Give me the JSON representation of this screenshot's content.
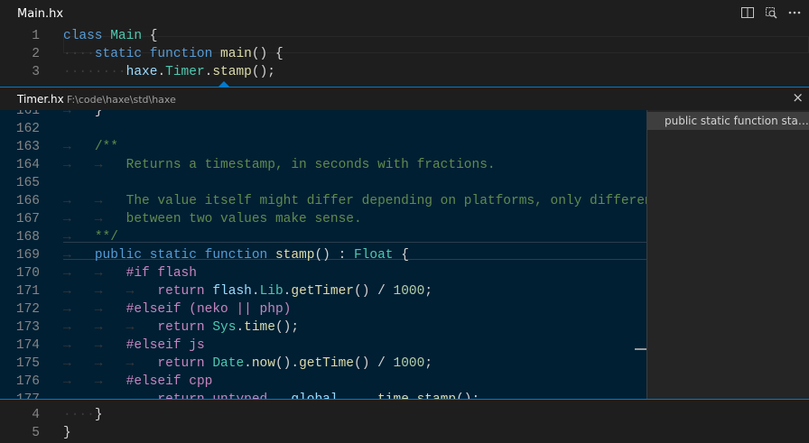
{
  "editor": {
    "tab_title": "Main.hx",
    "actions": [
      "split-editor-icon",
      "open-changes-icon",
      "more-actions-icon"
    ],
    "top_lines": [
      {
        "n": "1",
        "tokens": [
          [
            "kw",
            "class "
          ],
          [
            "ty",
            "Main"
          ],
          [
            "pl",
            " {"
          ]
        ]
      },
      {
        "n": "2",
        "tokens": [
          [
            "ws",
            "····"
          ],
          [
            "kw",
            "static function "
          ],
          [
            "fn",
            "main"
          ],
          [
            "pl",
            "() {"
          ]
        ]
      },
      {
        "n": "3",
        "tokens": [
          [
            "ws",
            "········"
          ],
          [
            "id",
            "haxe"
          ],
          [
            "pl",
            "."
          ],
          [
            "ty",
            "Timer"
          ],
          [
            "pl",
            "."
          ],
          [
            "fn",
            "stamp"
          ],
          [
            "pl",
            "();"
          ]
        ]
      }
    ],
    "bottom_lines": [
      {
        "n": "4",
        "tokens": [
          [
            "ws",
            "····"
          ],
          [
            "pl",
            "}"
          ]
        ]
      },
      {
        "n": "5",
        "tokens": [
          [
            "pl",
            "}"
          ]
        ]
      }
    ]
  },
  "peek": {
    "file": "Timer.hx",
    "path": "F:\\code\\haxe\\std\\haxe",
    "close_label": "×",
    "reference": "public static function stamp() : Float",
    "lines": [
      {
        "n": "161",
        "tokens": [
          [
            "ws",
            "→   "
          ],
          [
            "pl",
            "}"
          ]
        ]
      },
      {
        "n": "162",
        "tokens": []
      },
      {
        "n": "163",
        "tokens": [
          [
            "ws",
            "→   "
          ],
          [
            "cm",
            "/**"
          ]
        ]
      },
      {
        "n": "164",
        "tokens": [
          [
            "ws",
            "→   →   "
          ],
          [
            "cm",
            "Returns a timestamp, in seconds with fractions."
          ]
        ]
      },
      {
        "n": "165",
        "tokens": []
      },
      {
        "n": "166",
        "tokens": [
          [
            "ws",
            "→   →   "
          ],
          [
            "cm",
            "The value itself might differ depending on platforms, only differences"
          ]
        ]
      },
      {
        "n": "167",
        "tokens": [
          [
            "ws",
            "→   →   "
          ],
          [
            "cm",
            "between two values make sense."
          ]
        ]
      },
      {
        "n": "168",
        "tokens": [
          [
            "ws",
            "→   "
          ],
          [
            "cm",
            "**/"
          ]
        ]
      },
      {
        "n": "169",
        "tokens": [
          [
            "ws",
            "→   "
          ],
          [
            "kw",
            "public static function "
          ],
          [
            "fn",
            "stamp"
          ],
          [
            "pl",
            "() : "
          ],
          [
            "ty",
            "Float"
          ],
          [
            "pl",
            " {"
          ]
        ]
      },
      {
        "n": "170",
        "tokens": [
          [
            "ws",
            "→   →   "
          ],
          [
            "pp",
            "#if flash"
          ]
        ]
      },
      {
        "n": "171",
        "tokens": [
          [
            "ws",
            "→   →   →   "
          ],
          [
            "pp",
            "return "
          ],
          [
            "id",
            "flash"
          ],
          [
            "pl",
            "."
          ],
          [
            "ty",
            "Lib"
          ],
          [
            "pl",
            "."
          ],
          [
            "fn",
            "getTimer"
          ],
          [
            "pl",
            "() / "
          ],
          [
            "num",
            "1000"
          ],
          [
            "pl",
            ";"
          ]
        ]
      },
      {
        "n": "172",
        "tokens": [
          [
            "ws",
            "→   →   "
          ],
          [
            "pp",
            "#elseif (neko || php)"
          ]
        ]
      },
      {
        "n": "173",
        "tokens": [
          [
            "ws",
            "→   →   →   "
          ],
          [
            "pp",
            "return "
          ],
          [
            "ty",
            "Sys"
          ],
          [
            "pl",
            "."
          ],
          [
            "fn",
            "time"
          ],
          [
            "pl",
            "();"
          ]
        ]
      },
      {
        "n": "174",
        "tokens": [
          [
            "ws",
            "→   →   "
          ],
          [
            "pp",
            "#elseif js"
          ]
        ]
      },
      {
        "n": "175",
        "tokens": [
          [
            "ws",
            "→   →   →   "
          ],
          [
            "pp",
            "return "
          ],
          [
            "ty",
            "Date"
          ],
          [
            "pl",
            "."
          ],
          [
            "fn",
            "now"
          ],
          [
            "pl",
            "()."
          ],
          [
            "fn",
            "getTime"
          ],
          [
            "pl",
            "() / "
          ],
          [
            "num",
            "1000"
          ],
          [
            "pl",
            ";"
          ]
        ]
      },
      {
        "n": "176",
        "tokens": [
          [
            "ws",
            "→   →   "
          ],
          [
            "pp",
            "#elseif cpp"
          ]
        ]
      },
      {
        "n": "177",
        "tokens": [
          [
            "ws",
            "→   →   →   "
          ],
          [
            "pp",
            "return "
          ],
          [
            "pp",
            "untyped "
          ],
          [
            "id",
            "__global__"
          ],
          [
            "pl",
            "."
          ],
          [
            "fn",
            "__time_stamp"
          ],
          [
            "pl",
            "();"
          ]
        ]
      }
    ]
  }
}
